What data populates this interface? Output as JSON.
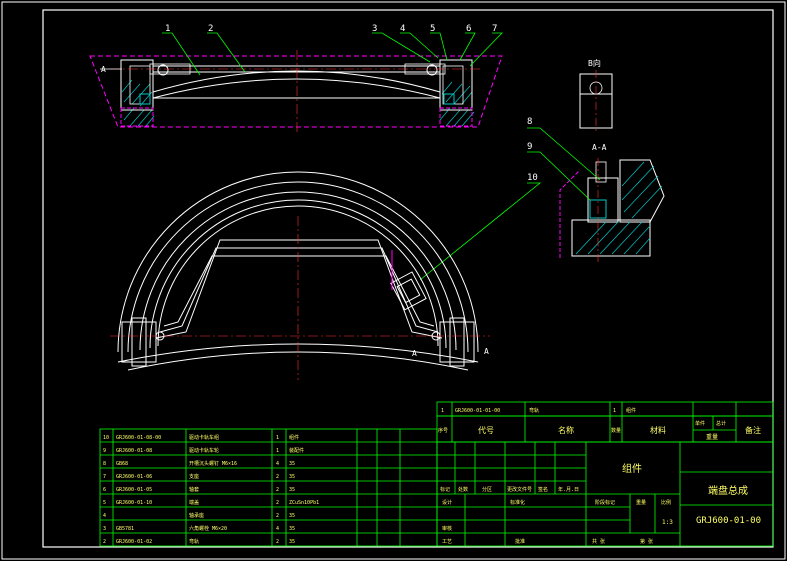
{
  "colors": {
    "background": "#000000",
    "outline": "#ffffff",
    "leader": "#00ff00",
    "hatch": "#00c8c8",
    "centerline": "#ff3030",
    "phantom": "#ff00ff",
    "table": "#00ff00",
    "table_text": "#ffff66"
  },
  "callouts": [
    "1",
    "2",
    "3",
    "4",
    "5",
    "6",
    "7",
    "8",
    "9",
    "10"
  ],
  "view_labels": {
    "section_left": "A",
    "section_right": "A",
    "detail_title": "A-A",
    "detail_top": "B向",
    "leader_right": "A"
  },
  "parts_list": {
    "rows": [
      {
        "no": "10",
        "code": "GRJ600-01-08-00",
        "name": "驱动卡轨车组",
        "qty": "1",
        "material": "组件"
      },
      {
        "no": "9",
        "code": "GRJ600-01-08",
        "name": "驱动卡轨车轮",
        "qty": "1",
        "material": "装配件"
      },
      {
        "no": "8",
        "code": "GB68",
        "name": "开槽沉头螺钉 M6×16",
        "qty": "4",
        "material": "35"
      },
      {
        "no": "7",
        "code": "GRJ600-01-06",
        "name": "支座",
        "qty": "2",
        "material": "35"
      },
      {
        "no": "6",
        "code": "GRJ600-01-05",
        "name": "轴套",
        "qty": "2",
        "material": "35"
      },
      {
        "no": "5",
        "code": "GRJ600-01-10",
        "name": "端盖",
        "qty": "2",
        "material": "ZCuSn10Pb1"
      },
      {
        "no": "4",
        "code": "",
        "name": "轴承座",
        "qty": "2",
        "material": "35"
      },
      {
        "no": "3",
        "code": "GB5781",
        "name": "六角螺栓 M6×20",
        "qty": "4",
        "material": "35"
      },
      {
        "no": "2",
        "code": "GRJ600-01-02",
        "name": "弯轨",
        "qty": "2",
        "material": "35"
      }
    ],
    "header_row": {
      "no": "1",
      "code": "GRJ600-01-01-00",
      "name": "弯轨",
      "qty": "1",
      "material": "组件"
    },
    "header_labels": {
      "no": "序号",
      "code": "代号",
      "name": "名称",
      "qty": "数量",
      "material": "材料",
      "single_weight": "单件",
      "total_weight": "总计",
      "weight": "重量",
      "remark": "备注"
    }
  },
  "title_block": {
    "material_label": "组件",
    "title": "端盘总成",
    "drawing_no": "GRJ600-01-00",
    "scale": "1:3",
    "labels": {
      "mark": "标记",
      "count": "处数",
      "zone": "分区",
      "change_doc": "更改文件号",
      "signature": "签名",
      "date": "年.月.日",
      "design": "设计",
      "standardize": "标准化",
      "stage_mark": "阶段标记",
      "weight": "重量",
      "scale": "比例",
      "review": "审核",
      "process": "工艺",
      "approve": "批准",
      "sheets_total": "共  张",
      "sheet_no": "第  张"
    }
  }
}
